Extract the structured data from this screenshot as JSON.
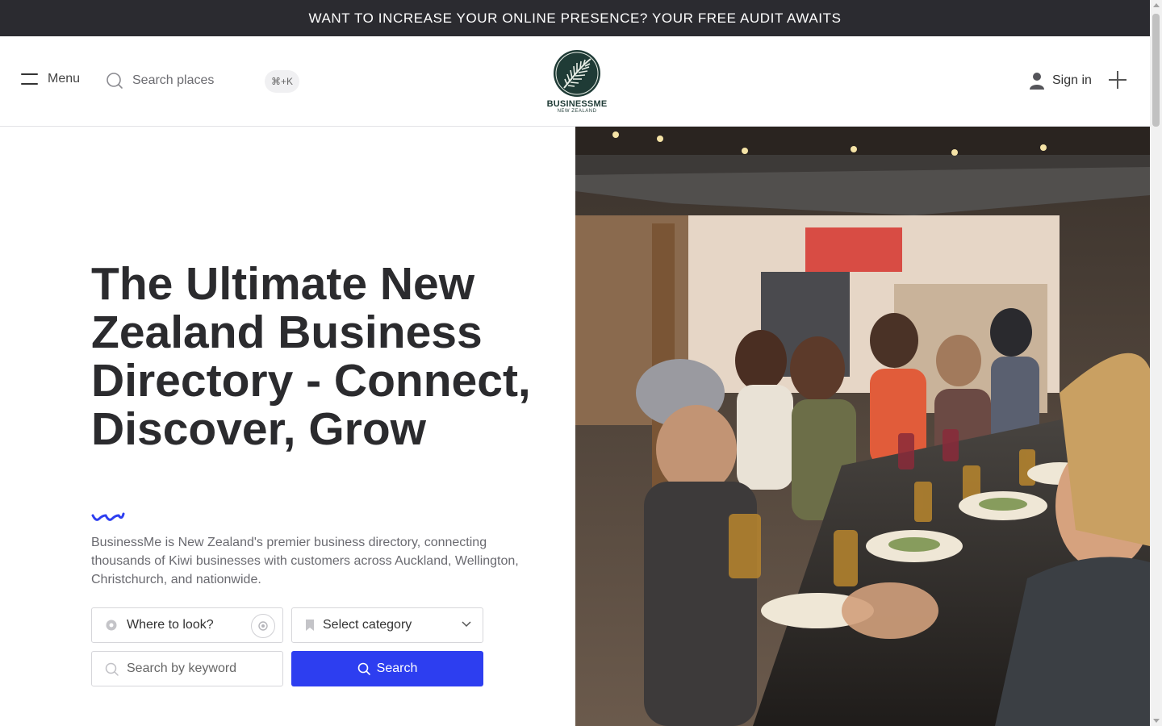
{
  "banner": {
    "text": "WANT TO INCREASE YOUR ONLINE PRESENCE? YOUR FREE AUDIT AWAITS"
  },
  "header": {
    "menu_label": "Menu",
    "search_placeholder": "Search places",
    "shortcut": "⌘+K",
    "logo_title": "BUSINESSME",
    "logo_subtitle": "NEW ZEALAND",
    "signin_label": "Sign in"
  },
  "hero": {
    "headline": "The Ultimate New Zealand Business Directory - Connect, Discover, Grow",
    "description": "BusinessMe is New Zealand's premier business directory, connecting thousands of Kiwi businesses with customers across Auckland, Wellington, Christchurch, and nationwide.",
    "accent_color": "#2d3ef0"
  },
  "search_form": {
    "where_placeholder": "Where to look?",
    "category_selected": "Select category",
    "keyword_placeholder": "Search by keyword",
    "search_button": "Search"
  },
  "icons": [
    "hamburger-icon",
    "search-icon",
    "user-icon",
    "plus-icon",
    "location-pin-icon",
    "locate-icon",
    "bookmark-icon",
    "chevron-down-icon"
  ]
}
